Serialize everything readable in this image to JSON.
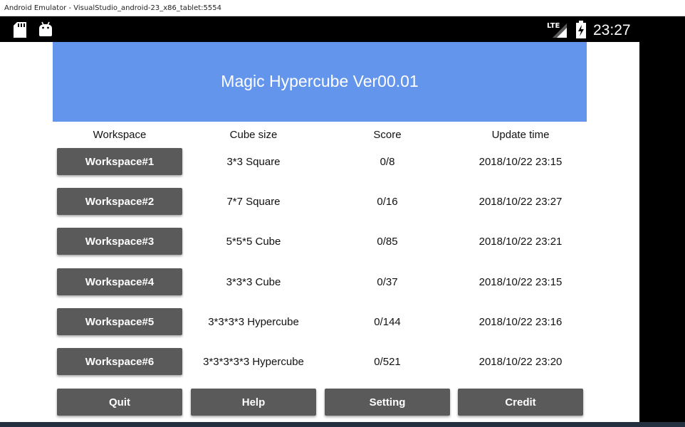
{
  "window": {
    "title": "Android Emulator - VisualStudio_android-23_x86_tablet:5554"
  },
  "status_bar": {
    "time": "23:27",
    "network": "LTE",
    "icons": [
      "sd-card-icon",
      "android-debug-icon",
      "lte-signal-icon",
      "battery-charging-icon"
    ]
  },
  "app": {
    "title": "Magic Hypercube Ver00.01",
    "colors": {
      "header": "#6495ed",
      "button": "#5a5a5a"
    },
    "columns": [
      "Workspace",
      "Cube size",
      "Score",
      "Update time"
    ],
    "rows": [
      {
        "workspace": "Workspace#1",
        "size": "3*3 Square",
        "score": "0/8",
        "time": "2018/10/22 23:15"
      },
      {
        "workspace": "Workspace#2",
        "size": "7*7 Square",
        "score": "0/16",
        "time": "2018/10/22 23:27"
      },
      {
        "workspace": "Workspace#3",
        "size": "5*5*5 Cube",
        "score": "0/85",
        "time": "2018/10/22 23:21"
      },
      {
        "workspace": "Workspace#4",
        "size": "3*3*3 Cube",
        "score": "0/37",
        "time": "2018/10/22 23:15"
      },
      {
        "workspace": "Workspace#5",
        "size": "3*3*3*3 Hypercube",
        "score": "0/144",
        "time": "2018/10/22 23:16"
      },
      {
        "workspace": "Workspace#6",
        "size": "3*3*3*3*3 Hypercube",
        "score": "0/521",
        "time": "2018/10/22 23:20"
      }
    ],
    "buttons": {
      "quit": "Quit",
      "help": "Help",
      "setting": "Setting",
      "credit": "Credit"
    }
  }
}
